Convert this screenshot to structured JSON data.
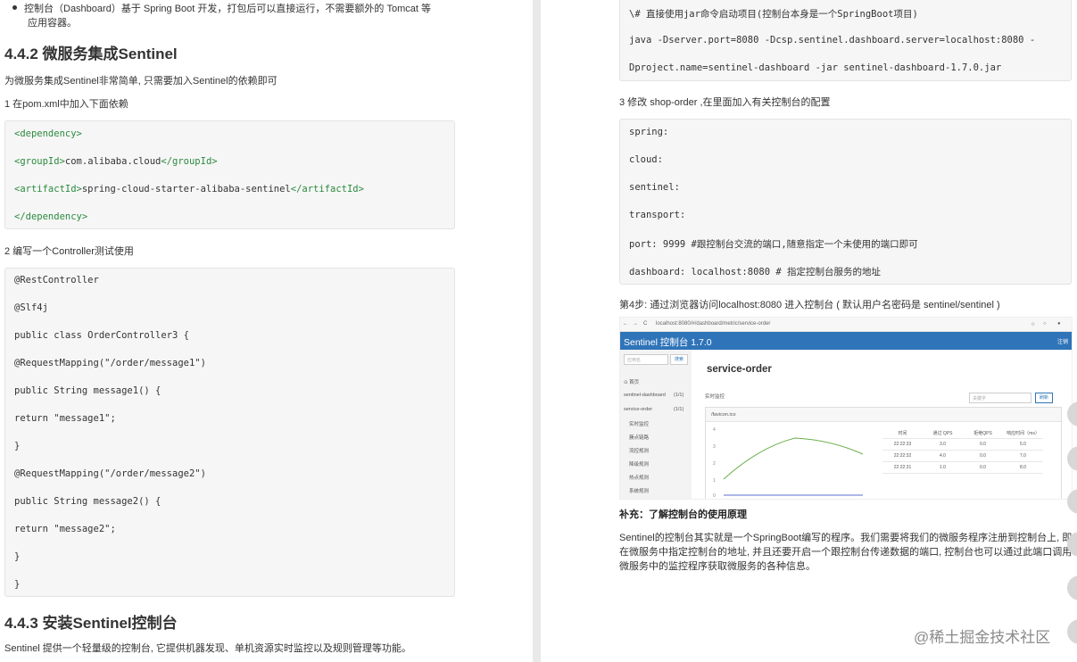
{
  "left": {
    "bullet_line1": "控制台（Dashboard）基于 Spring Boot 开发，打包后可以直接运行，不需要额外的 Tomcat 等",
    "bullet_line2": "应用容器。",
    "h442": "4.4.2 微服务集成Sentinel",
    "p_intro": "为微服务集成Sentinel非常简单, 只需要加入Sentinel的依赖即可",
    "p_step1": "1 在pom.xml中加入下面依赖",
    "pom": [
      {
        "open": "<dependency>",
        "text": "",
        "close": ""
      },
      {
        "open": "<groupId>",
        "text": "com.alibaba.cloud",
        "close": "</groupId>"
      },
      {
        "open": "<artifactId>",
        "text": "spring-cloud-starter-alibaba-sentinel",
        "close": "</artifactId>"
      },
      {
        "open": "</dependency>",
        "text": "",
        "close": ""
      }
    ],
    "p_step2": "2 编写一个Controller测试使用",
    "controller": [
      "@RestController",
      "@Slf4j",
      "public class OrderController3 {",
      "@RequestMapping(\"/order/message1\")",
      "public String message1() {",
      "return \"message1\";",
      "}",
      "@RequestMapping(\"/order/message2\")",
      "public String message2() {",
      "return \"message2\";",
      "}",
      "}"
    ],
    "h443": "4.4.3 安装Sentinel控制台",
    "p_last": "Sentinel 提供一个轻量级的控制台, 它提供机器发现、单机资源实时监控以及规则管理等功能。"
  },
  "right": {
    "cmd": [
      "\\# 直接使用jar命令启动项目(控制台本身是一个SpringBoot项目)",
      "java -Dserver.port=8080 -Dcsp.sentinel.dashboard.server=localhost:8080 -",
      "Dproject.name=sentinel-dashboard -jar sentinel-dashboard-1.7.0.jar"
    ],
    "p_step3": "3 修改 shop-order ,在里面加入有关控制台的配置",
    "yml": [
      "spring:",
      "cloud:",
      "sentinel:",
      "transport:",
      "port: 9999 #跟控制台交流的端口,随意指定一个未使用的端口即可",
      "dashboard: localhost:8080 # 指定控制台服务的地址"
    ],
    "p_step4": "第4步: 通过浏览器访问localhost:8080 进入控制台 ( 默认用户名密码是 sentinel/sentinel )",
    "screenshot": {
      "url": "localhost:8080/#/dashboard/metric/service-order",
      "app_title": "Sentinel 控制台 1.7.0",
      "logout": "注销",
      "search_placeholder": "应用名",
      "search_btn": "搜索",
      "side_items": [
        "首页",
        "sentinel-dashboard",
        "(1/1)",
        "service-order",
        "(1/1)",
        "实时监控",
        "簇点链路",
        "流控规则",
        "降级规则",
        "热点规则",
        "系统规则"
      ],
      "service_title": "service-order",
      "realtime": "实时监控",
      "keyword_placeholder": "关键字",
      "refresh": "刷新",
      "resource": "/favicon.ico",
      "table_headers": [
        "时间",
        "通过 QPS",
        "拒绝QPS",
        "响应时间（ms）"
      ],
      "table_rows": [
        [
          "22:22:33",
          "3.0",
          "0.0",
          "5.0"
        ],
        [
          "22:22:32",
          "4.0",
          "0.0",
          "7.0"
        ],
        [
          "22:22:31",
          "1.0",
          "0.0",
          "8.0"
        ]
      ],
      "y_ticks": [
        "4",
        "3",
        "2",
        "1",
        "0"
      ]
    },
    "subtitle": "补充：了解控制台的使用原理",
    "para": "Sentinel的控制台其实就是一个SpringBoot编写的程序。我们需要将我们的微服务程序注册到控制台上, 即在微服务中指定控制台的地址, 并且还要开启一个跟控制台传递数据的端口, 控制台也可以通过此端口调用微服务中的监控程序获取微服务的各种信息。",
    "watermark": "@稀土掘金技术社区"
  }
}
